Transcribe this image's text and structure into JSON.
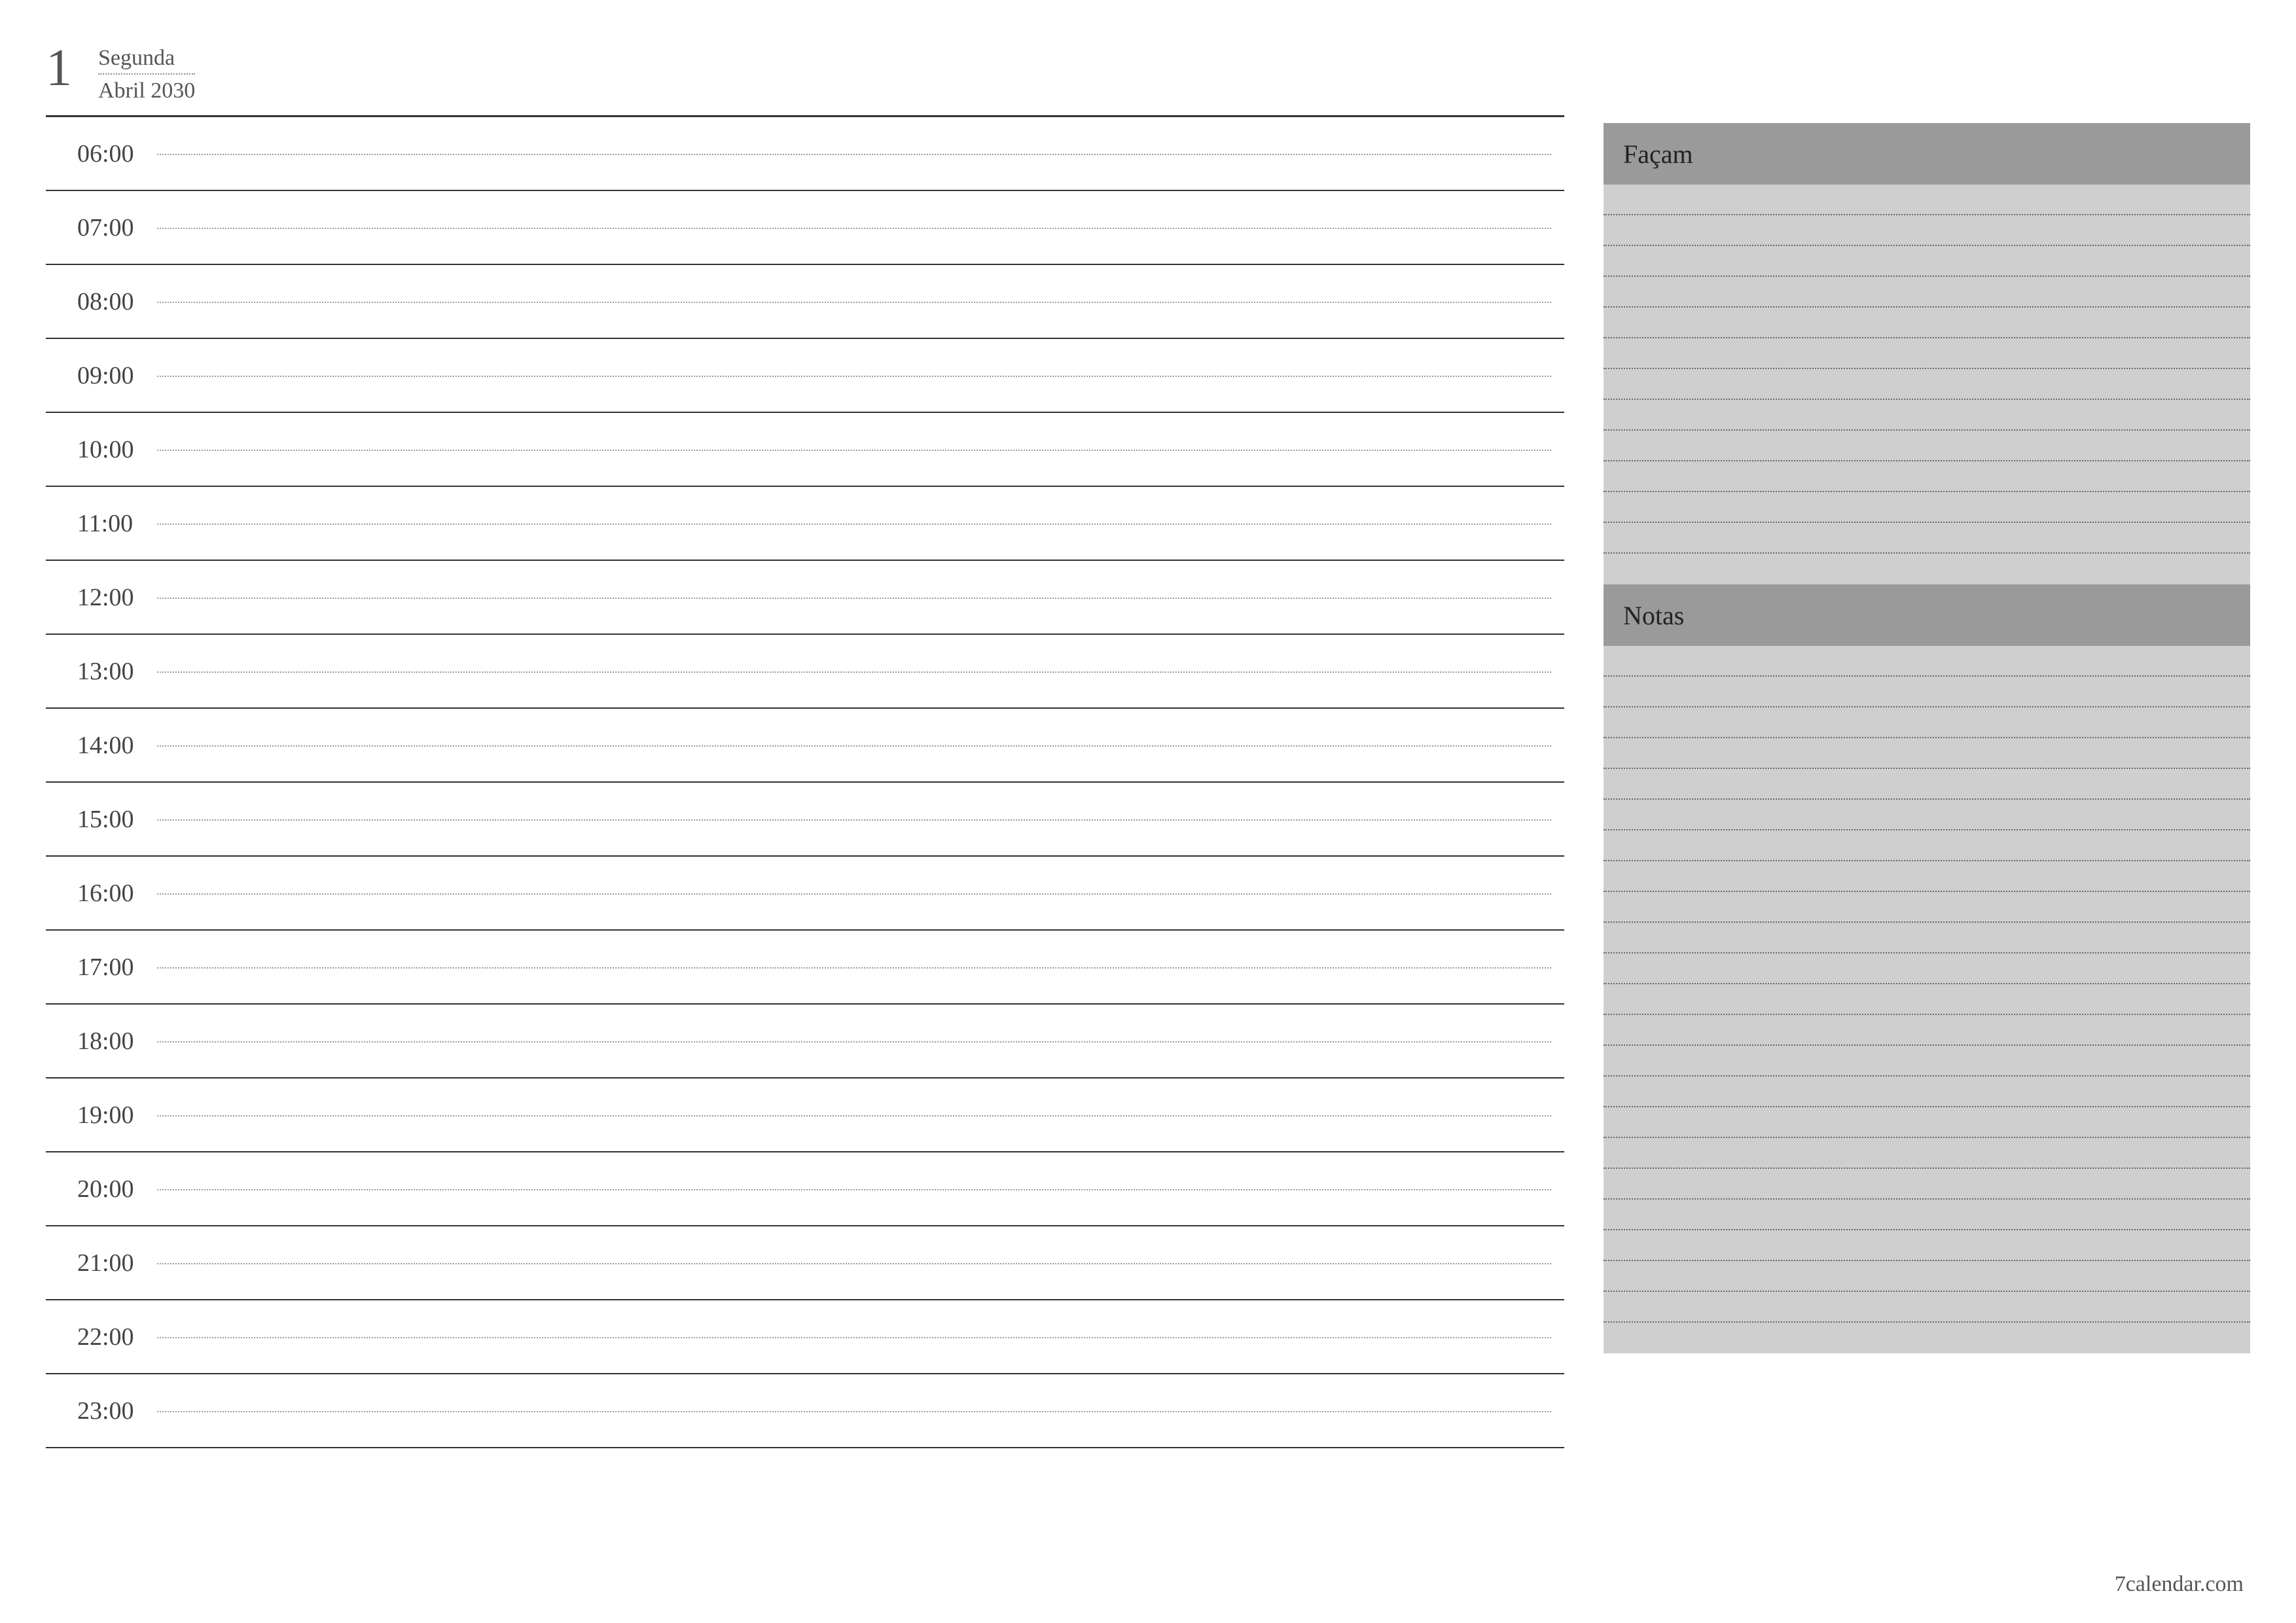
{
  "header": {
    "day_number": "1",
    "weekday": "Segunda",
    "month_year": "Abril 2030"
  },
  "schedule": {
    "hours": [
      "06:00",
      "07:00",
      "08:00",
      "09:00",
      "10:00",
      "11:00",
      "12:00",
      "13:00",
      "14:00",
      "15:00",
      "16:00",
      "17:00",
      "18:00",
      "19:00",
      "20:00",
      "21:00",
      "22:00",
      "23:00"
    ]
  },
  "sidebar": {
    "todo_label": "Façam",
    "notes_label": "Notas",
    "todo_lines": 13,
    "notes_lines": 23
  },
  "footer": {
    "site": "7calendar.com"
  }
}
